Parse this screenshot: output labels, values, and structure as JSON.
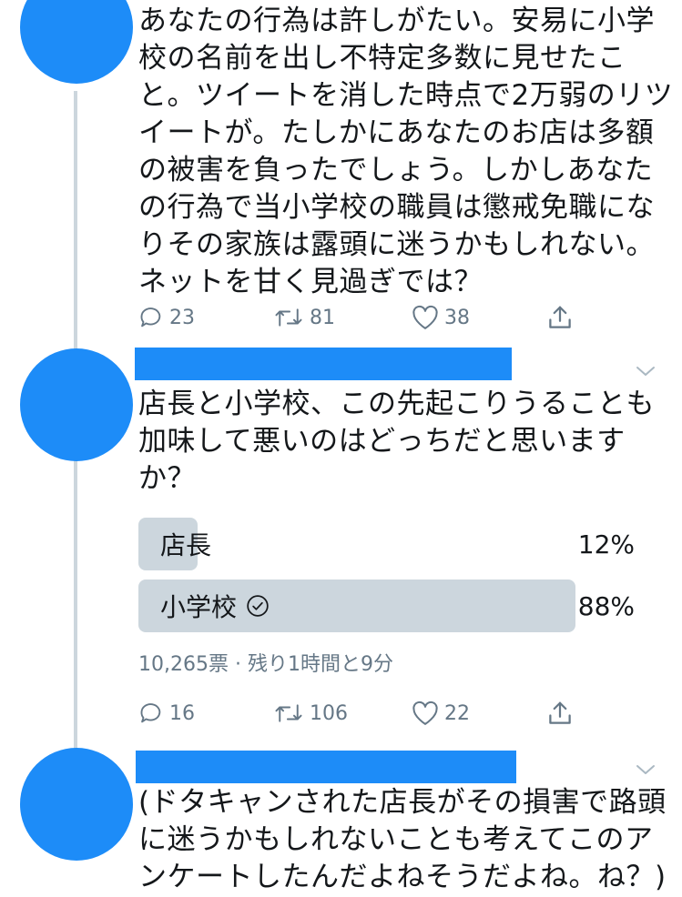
{
  "tweets": [
    {
      "text_lines": [
        "あなたの行為は許しがたい。安易に小学",
        "校の名前を出し不特定多数に見せたこ",
        "と。ツイートを消した時点で2万弱のリツ",
        "イートが。たしかにあなたのお店は多額",
        "の被害を負ったでしょう。しかしあなた",
        "の行為で当小学校の職員は懲戒免職にな",
        "りその家族は露頭に迷うかもしれない。",
        "ネットを甘く見過ぎでは？"
      ],
      "replies": "23",
      "retweets": "81",
      "likes": "38"
    },
    {
      "text_lines": [
        "店長と小学校、この先起こりうることも",
        "加味して悪いのはどっちだと思います",
        "か？"
      ],
      "poll": {
        "options": [
          {
            "label": "店長",
            "percent_text": "12%",
            "share": 0.12,
            "selected": false
          },
          {
            "label": "小学校",
            "percent_text": "88%",
            "share": 0.88,
            "selected": true
          }
        ],
        "meta": "10,265票 · 残り1時間と9分"
      },
      "replies": "16",
      "retweets": "106",
      "likes": "22"
    },
    {
      "text_lines": [
        "(ドタキャンされた店長がその損害で路頭",
        "に迷うかもしれないことも考えてこのア",
        "ンケートしたんだよねそうだよね。ね？)"
      ]
    }
  ],
  "colors": {
    "avatar": "#1d8cf8",
    "redaction": "#1d8cf8",
    "thread_line": "#ccd6dd",
    "poll_bar": "#ccd6dd",
    "muted_text": "#657786",
    "text": "#14171a"
  },
  "icons": [
    "reply-icon",
    "retweet-icon",
    "like-icon",
    "share-icon",
    "chevron-down-icon",
    "check-circle-icon"
  ]
}
